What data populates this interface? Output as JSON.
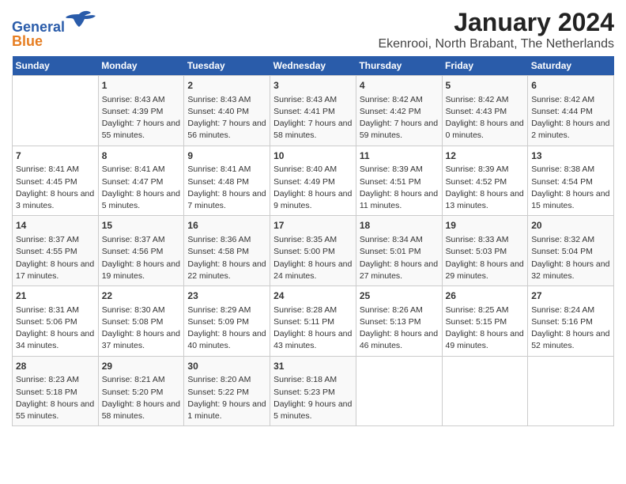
{
  "header": {
    "logo": {
      "line1": "General",
      "line2": "Blue"
    },
    "title": "January 2024",
    "subtitle": "Ekenrooi, North Brabant, The Netherlands"
  },
  "columns": [
    "Sunday",
    "Monday",
    "Tuesday",
    "Wednesday",
    "Thursday",
    "Friday",
    "Saturday"
  ],
  "weeks": [
    [
      {
        "day": "",
        "info": ""
      },
      {
        "day": "1",
        "info": "Sunrise: 8:43 AM\nSunset: 4:39 PM\nDaylight: 7 hours\nand 55 minutes."
      },
      {
        "day": "2",
        "info": "Sunrise: 8:43 AM\nSunset: 4:40 PM\nDaylight: 7 hours\nand 56 minutes."
      },
      {
        "day": "3",
        "info": "Sunrise: 8:43 AM\nSunset: 4:41 PM\nDaylight: 7 hours\nand 58 minutes."
      },
      {
        "day": "4",
        "info": "Sunrise: 8:42 AM\nSunset: 4:42 PM\nDaylight: 7 hours\nand 59 minutes."
      },
      {
        "day": "5",
        "info": "Sunrise: 8:42 AM\nSunset: 4:43 PM\nDaylight: 8 hours\nand 0 minutes."
      },
      {
        "day": "6",
        "info": "Sunrise: 8:42 AM\nSunset: 4:44 PM\nDaylight: 8 hours\nand 2 minutes."
      }
    ],
    [
      {
        "day": "7",
        "info": "Sunrise: 8:41 AM\nSunset: 4:45 PM\nDaylight: 8 hours\nand 3 minutes."
      },
      {
        "day": "8",
        "info": "Sunrise: 8:41 AM\nSunset: 4:47 PM\nDaylight: 8 hours\nand 5 minutes."
      },
      {
        "day": "9",
        "info": "Sunrise: 8:41 AM\nSunset: 4:48 PM\nDaylight: 8 hours\nand 7 minutes."
      },
      {
        "day": "10",
        "info": "Sunrise: 8:40 AM\nSunset: 4:49 PM\nDaylight: 8 hours\nand 9 minutes."
      },
      {
        "day": "11",
        "info": "Sunrise: 8:39 AM\nSunset: 4:51 PM\nDaylight: 8 hours\nand 11 minutes."
      },
      {
        "day": "12",
        "info": "Sunrise: 8:39 AM\nSunset: 4:52 PM\nDaylight: 8 hours\nand 13 minutes."
      },
      {
        "day": "13",
        "info": "Sunrise: 8:38 AM\nSunset: 4:54 PM\nDaylight: 8 hours\nand 15 minutes."
      }
    ],
    [
      {
        "day": "14",
        "info": "Sunrise: 8:37 AM\nSunset: 4:55 PM\nDaylight: 8 hours\nand 17 minutes."
      },
      {
        "day": "15",
        "info": "Sunrise: 8:37 AM\nSunset: 4:56 PM\nDaylight: 8 hours\nand 19 minutes."
      },
      {
        "day": "16",
        "info": "Sunrise: 8:36 AM\nSunset: 4:58 PM\nDaylight: 8 hours\nand 22 minutes."
      },
      {
        "day": "17",
        "info": "Sunrise: 8:35 AM\nSunset: 5:00 PM\nDaylight: 8 hours\nand 24 minutes."
      },
      {
        "day": "18",
        "info": "Sunrise: 8:34 AM\nSunset: 5:01 PM\nDaylight: 8 hours\nand 27 minutes."
      },
      {
        "day": "19",
        "info": "Sunrise: 8:33 AM\nSunset: 5:03 PM\nDaylight: 8 hours\nand 29 minutes."
      },
      {
        "day": "20",
        "info": "Sunrise: 8:32 AM\nSunset: 5:04 PM\nDaylight: 8 hours\nand 32 minutes."
      }
    ],
    [
      {
        "day": "21",
        "info": "Sunrise: 8:31 AM\nSunset: 5:06 PM\nDaylight: 8 hours\nand 34 minutes."
      },
      {
        "day": "22",
        "info": "Sunrise: 8:30 AM\nSunset: 5:08 PM\nDaylight: 8 hours\nand 37 minutes."
      },
      {
        "day": "23",
        "info": "Sunrise: 8:29 AM\nSunset: 5:09 PM\nDaylight: 8 hours\nand 40 minutes."
      },
      {
        "day": "24",
        "info": "Sunrise: 8:28 AM\nSunset: 5:11 PM\nDaylight: 8 hours\nand 43 minutes."
      },
      {
        "day": "25",
        "info": "Sunrise: 8:26 AM\nSunset: 5:13 PM\nDaylight: 8 hours\nand 46 minutes."
      },
      {
        "day": "26",
        "info": "Sunrise: 8:25 AM\nSunset: 5:15 PM\nDaylight: 8 hours\nand 49 minutes."
      },
      {
        "day": "27",
        "info": "Sunrise: 8:24 AM\nSunset: 5:16 PM\nDaylight: 8 hours\nand 52 minutes."
      }
    ],
    [
      {
        "day": "28",
        "info": "Sunrise: 8:23 AM\nSunset: 5:18 PM\nDaylight: 8 hours\nand 55 minutes."
      },
      {
        "day": "29",
        "info": "Sunrise: 8:21 AM\nSunset: 5:20 PM\nDaylight: 8 hours\nand 58 minutes."
      },
      {
        "day": "30",
        "info": "Sunrise: 8:20 AM\nSunset: 5:22 PM\nDaylight: 9 hours\nand 1 minute."
      },
      {
        "day": "31",
        "info": "Sunrise: 8:18 AM\nSunset: 5:23 PM\nDaylight: 9 hours\nand 5 minutes."
      },
      {
        "day": "",
        "info": ""
      },
      {
        "day": "",
        "info": ""
      },
      {
        "day": "",
        "info": ""
      }
    ]
  ]
}
